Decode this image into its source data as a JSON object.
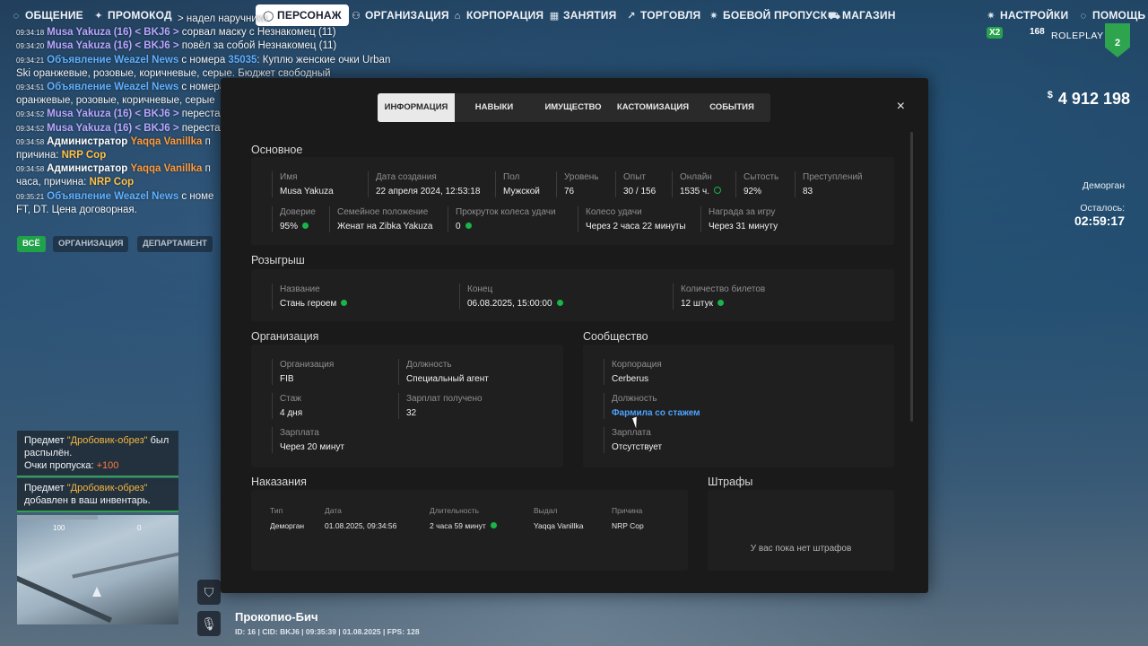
{
  "nav": {
    "left": [
      {
        "id": "chat",
        "icon": "chat-icon",
        "label": "ОБЩЕНИЕ"
      },
      {
        "id": "promo",
        "icon": "gamepad-icon",
        "label": "ПРОМОКОД"
      },
      {
        "id": "character",
        "icon": "user-icon",
        "label": "ПЕРСОНАЖ",
        "active": true
      },
      {
        "id": "org",
        "icon": "users-icon",
        "label": "ОРГАНИЗАЦИЯ"
      },
      {
        "id": "corp",
        "icon": "corporation-icon",
        "label": "КОРПОРАЦИЯ"
      },
      {
        "id": "lessons",
        "icon": "calendar-icon",
        "label": "ЗАНЯТИЯ"
      },
      {
        "id": "trade",
        "icon": "chart-icon",
        "label": "ТОРГОВЛЯ"
      },
      {
        "id": "pass",
        "icon": "gear-icon",
        "label": "БОЕВОЙ ПРОПУСК"
      },
      {
        "id": "shop",
        "icon": "cart-icon",
        "label": "МАГАЗИН"
      }
    ],
    "right": [
      {
        "id": "settings",
        "icon": "gear-icon",
        "label": "НАСТРОЙКИ"
      },
      {
        "id": "help",
        "icon": "help-icon",
        "label": "ПОМОЩЬ"
      }
    ]
  },
  "chat": {
    "lines": [
      {
        "ts": "",
        "parts": [
          {
            "c": "",
            "t": "> надел наручники"
          }
        ]
      },
      {
        "ts": "09:34:18",
        "parts": [
          {
            "c": "nm",
            "t": "Musa Yakuza (16) < BKJ6 >"
          },
          {
            "c": "",
            "t": " сорвал маску с Незнакомец (11)"
          }
        ]
      },
      {
        "ts": "09:34:20",
        "parts": [
          {
            "c": "nm",
            "t": "Musa Yakuza (16) < BKJ6 >"
          },
          {
            "c": "",
            "t": " повёл за собой Незнакомец (11)"
          }
        ]
      },
      {
        "ts": "09:34:21",
        "parts": [
          {
            "c": "ad",
            "t": "Объявление Weazel News"
          },
          {
            "c": "",
            "t": " с номера "
          },
          {
            "c": "num",
            "t": "35035"
          },
          {
            "c": "",
            "t": ": Куплю женские очки Urban"
          }
        ]
      },
      {
        "ts": "",
        "parts": [
          {
            "c": "",
            "t": "Ski оранжевые, розовые, коричневые, серые. Бюджет свободный"
          }
        ]
      },
      {
        "ts": "09:34:51",
        "parts": [
          {
            "c": "ad",
            "t": "Объявление Weazel News"
          },
          {
            "c": "",
            "t": " с номера"
          }
        ]
      },
      {
        "ts": "",
        "parts": [
          {
            "c": "",
            "t": "оранжевые, розовые, коричневые, серые"
          }
        ]
      },
      {
        "ts": "09:34:52",
        "parts": [
          {
            "c": "nm",
            "t": "Musa Yakuza (16) < BKJ6 >"
          },
          {
            "c": "",
            "t": " перестал"
          }
        ]
      },
      {
        "ts": "09:34:52",
        "parts": [
          {
            "c": "nm",
            "t": "Musa Yakuza (16) < BKJ6 >"
          },
          {
            "c": "",
            "t": " перестал"
          }
        ]
      },
      {
        "ts": "09:34:58",
        "parts": [
          {
            "c": "adm",
            "t": "Администратор"
          },
          {
            "c": "",
            "t": " "
          },
          {
            "c": "an",
            "t": "Yaqqa Vanillka"
          },
          {
            "c": "",
            "t": " п"
          }
        ]
      },
      {
        "ts": "",
        "parts": [
          {
            "c": "",
            "t": "причина: "
          },
          {
            "c": "reason",
            "t": "NRP Cop"
          }
        ]
      },
      {
        "ts": "09:34:58",
        "parts": [
          {
            "c": "adm",
            "t": "Администратор"
          },
          {
            "c": "",
            "t": " "
          },
          {
            "c": "an",
            "t": "Yaqqa Vanillka"
          },
          {
            "c": "",
            "t": " п"
          }
        ]
      },
      {
        "ts": "",
        "parts": [
          {
            "c": "",
            "t": "часа, причина: "
          },
          {
            "c": "reason",
            "t": "NRP Cop"
          }
        ]
      },
      {
        "ts": "09:35:21",
        "parts": [
          {
            "c": "ad",
            "t": "Объявление Weazel News"
          },
          {
            "c": "",
            "t": " с номе"
          }
        ]
      },
      {
        "ts": "",
        "parts": [
          {
            "c": "",
            "t": "FT, DT. Цена договорная."
          }
        ]
      }
    ],
    "tabs": [
      {
        "label": "ВСЁ",
        "active": true
      },
      {
        "label": "ОРГАНИЗАЦИЯ"
      },
      {
        "label": "ДЕПАРТАМЕНТ"
      }
    ]
  },
  "notifications": [
    {
      "p1": "Предмет ",
      "hl": "\"Дробовик-обрез\"",
      "p2": " был распылён.",
      "p3": "Очки пропуска: ",
      "gain": "+100"
    },
    {
      "p1": "Предмет ",
      "hl": "\"Дробовик-обрез\"",
      "p2": " добавлен в ваш инвентарь."
    }
  ],
  "minimap": {
    "hp_left": "100",
    "hp_right": "0"
  },
  "location": {
    "name": "Прокопио-Бич",
    "meta": "ID: 16 | CID: BKJ6 | 09:35:39 | 01.08.2025 | FPS: 128"
  },
  "hud": {
    "x2": "X2",
    "online": "168",
    "brand": "ROLEPLAY",
    "server": "2",
    "currency": "$",
    "money": "4 912 198",
    "status": "Деморган",
    "remain_label": "Осталось:",
    "remain_time": "02:59:17"
  },
  "modal": {
    "tabs": [
      "ИНФОРМАЦИЯ",
      "НАВЫКИ",
      "ИМУЩЕСТВО",
      "КАСТОМИЗАЦИЯ",
      "СОБЫТИЯ"
    ],
    "active_tab": 0,
    "close": "×",
    "basic": {
      "title": "Основное",
      "row1": [
        {
          "label": "Имя",
          "value": "Musa Yakuza"
        },
        {
          "label": "Дата создания",
          "value": "22 апреля 2024, 12:53:18"
        },
        {
          "label": "Пол",
          "value": "Мужской"
        },
        {
          "label": "Уровень",
          "value": "76"
        },
        {
          "label": "Опыт",
          "value": "30 / 156"
        },
        {
          "label": "Онлайн",
          "value": "1535 ч.",
          "dot": "ring"
        },
        {
          "label": "Сытость",
          "value": "92%"
        },
        {
          "label": "Преступлений",
          "value": "83"
        }
      ],
      "row2": [
        {
          "label": "Доверие",
          "value": "95%",
          "dot": "solid"
        },
        {
          "label": "Семейное положение",
          "value": "Женат на Zibka Yakuza"
        },
        {
          "label": "Прокруток колеса удачи",
          "value": "0",
          "dot": "solid"
        },
        {
          "label": "Колесо удачи",
          "value": "Через 2 часа 22 минуты"
        },
        {
          "label": "Награда за игру",
          "value": "Через 31 минуту"
        }
      ]
    },
    "raffle": {
      "title": "Розыгрыш",
      "fields": [
        {
          "label": "Название",
          "value": "Стань героем",
          "dot": "solid"
        },
        {
          "label": "Конец",
          "value": "06.08.2025, 15:00:00",
          "dot": "solid"
        },
        {
          "label": "Количество билетов",
          "value": "12 штук",
          "dot": "solid"
        }
      ]
    },
    "org": {
      "title": "Организация",
      "fields": [
        {
          "label": "Организация",
          "value": "FIB"
        },
        {
          "label": "Должность",
          "value": "Специальный агент"
        },
        {
          "label": "Стаж",
          "value": "4 дня"
        },
        {
          "label": "Зарплат получено",
          "value": "32"
        },
        {
          "label": "Зарплата",
          "value": "Через 20 минут"
        }
      ]
    },
    "community": {
      "title": "Сообщество",
      "fields": [
        {
          "label": "Корпорация",
          "value": "Cerberus"
        },
        {
          "label": "Должность",
          "value": "Фармила со стажем"
        },
        {
          "label": "Зарплата",
          "value": "Отсутствует"
        }
      ]
    },
    "punishments": {
      "title": "Наказания",
      "headers": [
        "Тип",
        "Дата",
        "Длительность",
        "Выдал",
        "Причина"
      ],
      "row": [
        "Деморган",
        "01.08.2025, 09:34:56",
        "2 часа 59 минут",
        "Yaqqa Vanillka",
        "NRP Cop"
      ]
    },
    "fines": {
      "title": "Штрафы",
      "empty": "У вас пока нет штрафов"
    }
  }
}
